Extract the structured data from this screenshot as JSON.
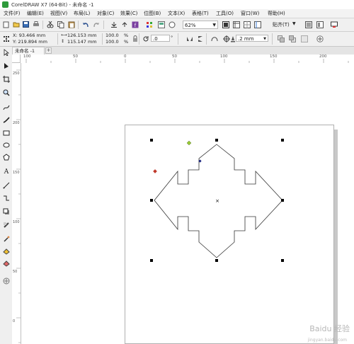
{
  "window": {
    "title": "CorelDRAW X7 (64-Bit) - 未命名 -1"
  },
  "menu": [
    "文件(F)",
    "编辑(E)",
    "视图(V)",
    "布局(L)",
    "对象(C)",
    "效果(C)",
    "位图(B)",
    "文本(X)",
    "表格(T)",
    "工具(O)",
    "窗口(W)",
    "帮助(H)"
  ],
  "toolbar": {
    "zoom_value": "62%",
    "snap_label": "贴齐(T)"
  },
  "properties": {
    "x_pos": "X: 93.466 mm",
    "y_pos": "Y: 219.894 mm",
    "width": "126.153 mm",
    "height": "115.147 mm",
    "scale_x": "100.0",
    "scale_y": "100.0",
    "percent": "%",
    "rotation": ".0",
    "degree": "°",
    "outline_width": ".2 mm"
  },
  "tab": {
    "doc_name": "未命名 -1",
    "add_symbol": "+"
  },
  "ruler": {
    "h_ticks": [
      "100",
      "50",
      "0",
      "50",
      "100",
      "150",
      "200"
    ],
    "v_ticks": [
      "250",
      "200",
      "150",
      "100",
      "50",
      "0"
    ]
  },
  "watermark": {
    "text": "Baidu 经验",
    "url": "jingyan.baidu.com"
  },
  "colors": {
    "accent": "#2e9a3b",
    "selection_handle": "#000000",
    "rotation_handle": "#c0392b",
    "skew_handle": "#9acd32",
    "node": "#1a237e"
  }
}
